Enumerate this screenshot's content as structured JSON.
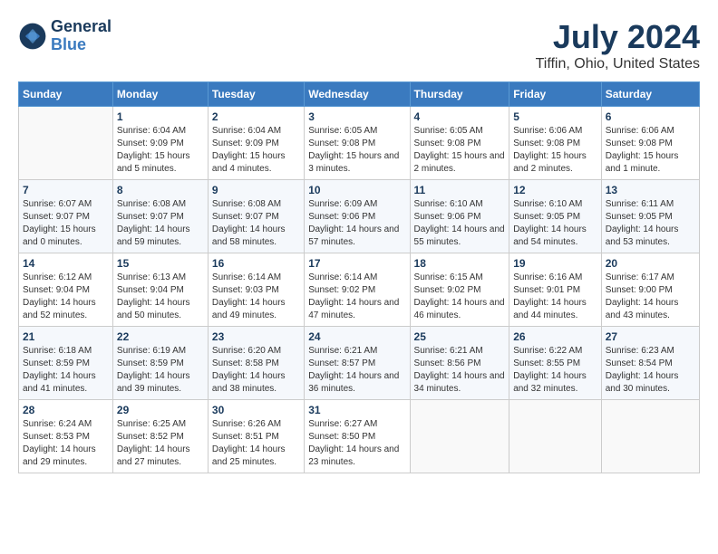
{
  "header": {
    "logo_line1": "General",
    "logo_line2": "Blue",
    "month": "July 2024",
    "location": "Tiffin, Ohio, United States"
  },
  "weekdays": [
    "Sunday",
    "Monday",
    "Tuesday",
    "Wednesday",
    "Thursday",
    "Friday",
    "Saturday"
  ],
  "weeks": [
    [
      {
        "day": "",
        "sunrise": "",
        "sunset": "",
        "daylight": ""
      },
      {
        "day": "1",
        "sunrise": "Sunrise: 6:04 AM",
        "sunset": "Sunset: 9:09 PM",
        "daylight": "Daylight: 15 hours and 5 minutes."
      },
      {
        "day": "2",
        "sunrise": "Sunrise: 6:04 AM",
        "sunset": "Sunset: 9:09 PM",
        "daylight": "Daylight: 15 hours and 4 minutes."
      },
      {
        "day": "3",
        "sunrise": "Sunrise: 6:05 AM",
        "sunset": "Sunset: 9:08 PM",
        "daylight": "Daylight: 15 hours and 3 minutes."
      },
      {
        "day": "4",
        "sunrise": "Sunrise: 6:05 AM",
        "sunset": "Sunset: 9:08 PM",
        "daylight": "Daylight: 15 hours and 2 minutes."
      },
      {
        "day": "5",
        "sunrise": "Sunrise: 6:06 AM",
        "sunset": "Sunset: 9:08 PM",
        "daylight": "Daylight: 15 hours and 2 minutes."
      },
      {
        "day": "6",
        "sunrise": "Sunrise: 6:06 AM",
        "sunset": "Sunset: 9:08 PM",
        "daylight": "Daylight: 15 hours and 1 minute."
      }
    ],
    [
      {
        "day": "7",
        "sunrise": "Sunrise: 6:07 AM",
        "sunset": "Sunset: 9:07 PM",
        "daylight": "Daylight: 15 hours and 0 minutes."
      },
      {
        "day": "8",
        "sunrise": "Sunrise: 6:08 AM",
        "sunset": "Sunset: 9:07 PM",
        "daylight": "Daylight: 14 hours and 59 minutes."
      },
      {
        "day": "9",
        "sunrise": "Sunrise: 6:08 AM",
        "sunset": "Sunset: 9:07 PM",
        "daylight": "Daylight: 14 hours and 58 minutes."
      },
      {
        "day": "10",
        "sunrise": "Sunrise: 6:09 AM",
        "sunset": "Sunset: 9:06 PM",
        "daylight": "Daylight: 14 hours and 57 minutes."
      },
      {
        "day": "11",
        "sunrise": "Sunrise: 6:10 AM",
        "sunset": "Sunset: 9:06 PM",
        "daylight": "Daylight: 14 hours and 55 minutes."
      },
      {
        "day": "12",
        "sunrise": "Sunrise: 6:10 AM",
        "sunset": "Sunset: 9:05 PM",
        "daylight": "Daylight: 14 hours and 54 minutes."
      },
      {
        "day": "13",
        "sunrise": "Sunrise: 6:11 AM",
        "sunset": "Sunset: 9:05 PM",
        "daylight": "Daylight: 14 hours and 53 minutes."
      }
    ],
    [
      {
        "day": "14",
        "sunrise": "Sunrise: 6:12 AM",
        "sunset": "Sunset: 9:04 PM",
        "daylight": "Daylight: 14 hours and 52 minutes."
      },
      {
        "day": "15",
        "sunrise": "Sunrise: 6:13 AM",
        "sunset": "Sunset: 9:04 PM",
        "daylight": "Daylight: 14 hours and 50 minutes."
      },
      {
        "day": "16",
        "sunrise": "Sunrise: 6:14 AM",
        "sunset": "Sunset: 9:03 PM",
        "daylight": "Daylight: 14 hours and 49 minutes."
      },
      {
        "day": "17",
        "sunrise": "Sunrise: 6:14 AM",
        "sunset": "Sunset: 9:02 PM",
        "daylight": "Daylight: 14 hours and 47 minutes."
      },
      {
        "day": "18",
        "sunrise": "Sunrise: 6:15 AM",
        "sunset": "Sunset: 9:02 PM",
        "daylight": "Daylight: 14 hours and 46 minutes."
      },
      {
        "day": "19",
        "sunrise": "Sunrise: 6:16 AM",
        "sunset": "Sunset: 9:01 PM",
        "daylight": "Daylight: 14 hours and 44 minutes."
      },
      {
        "day": "20",
        "sunrise": "Sunrise: 6:17 AM",
        "sunset": "Sunset: 9:00 PM",
        "daylight": "Daylight: 14 hours and 43 minutes."
      }
    ],
    [
      {
        "day": "21",
        "sunrise": "Sunrise: 6:18 AM",
        "sunset": "Sunset: 8:59 PM",
        "daylight": "Daylight: 14 hours and 41 minutes."
      },
      {
        "day": "22",
        "sunrise": "Sunrise: 6:19 AM",
        "sunset": "Sunset: 8:59 PM",
        "daylight": "Daylight: 14 hours and 39 minutes."
      },
      {
        "day": "23",
        "sunrise": "Sunrise: 6:20 AM",
        "sunset": "Sunset: 8:58 PM",
        "daylight": "Daylight: 14 hours and 38 minutes."
      },
      {
        "day": "24",
        "sunrise": "Sunrise: 6:21 AM",
        "sunset": "Sunset: 8:57 PM",
        "daylight": "Daylight: 14 hours and 36 minutes."
      },
      {
        "day": "25",
        "sunrise": "Sunrise: 6:21 AM",
        "sunset": "Sunset: 8:56 PM",
        "daylight": "Daylight: 14 hours and 34 minutes."
      },
      {
        "day": "26",
        "sunrise": "Sunrise: 6:22 AM",
        "sunset": "Sunset: 8:55 PM",
        "daylight": "Daylight: 14 hours and 32 minutes."
      },
      {
        "day": "27",
        "sunrise": "Sunrise: 6:23 AM",
        "sunset": "Sunset: 8:54 PM",
        "daylight": "Daylight: 14 hours and 30 minutes."
      }
    ],
    [
      {
        "day": "28",
        "sunrise": "Sunrise: 6:24 AM",
        "sunset": "Sunset: 8:53 PM",
        "daylight": "Daylight: 14 hours and 29 minutes."
      },
      {
        "day": "29",
        "sunrise": "Sunrise: 6:25 AM",
        "sunset": "Sunset: 8:52 PM",
        "daylight": "Daylight: 14 hours and 27 minutes."
      },
      {
        "day": "30",
        "sunrise": "Sunrise: 6:26 AM",
        "sunset": "Sunset: 8:51 PM",
        "daylight": "Daylight: 14 hours and 25 minutes."
      },
      {
        "day": "31",
        "sunrise": "Sunrise: 6:27 AM",
        "sunset": "Sunset: 8:50 PM",
        "daylight": "Daylight: 14 hours and 23 minutes."
      },
      {
        "day": "",
        "sunrise": "",
        "sunset": "",
        "daylight": ""
      },
      {
        "day": "",
        "sunrise": "",
        "sunset": "",
        "daylight": ""
      },
      {
        "day": "",
        "sunrise": "",
        "sunset": "",
        "daylight": ""
      }
    ]
  ]
}
